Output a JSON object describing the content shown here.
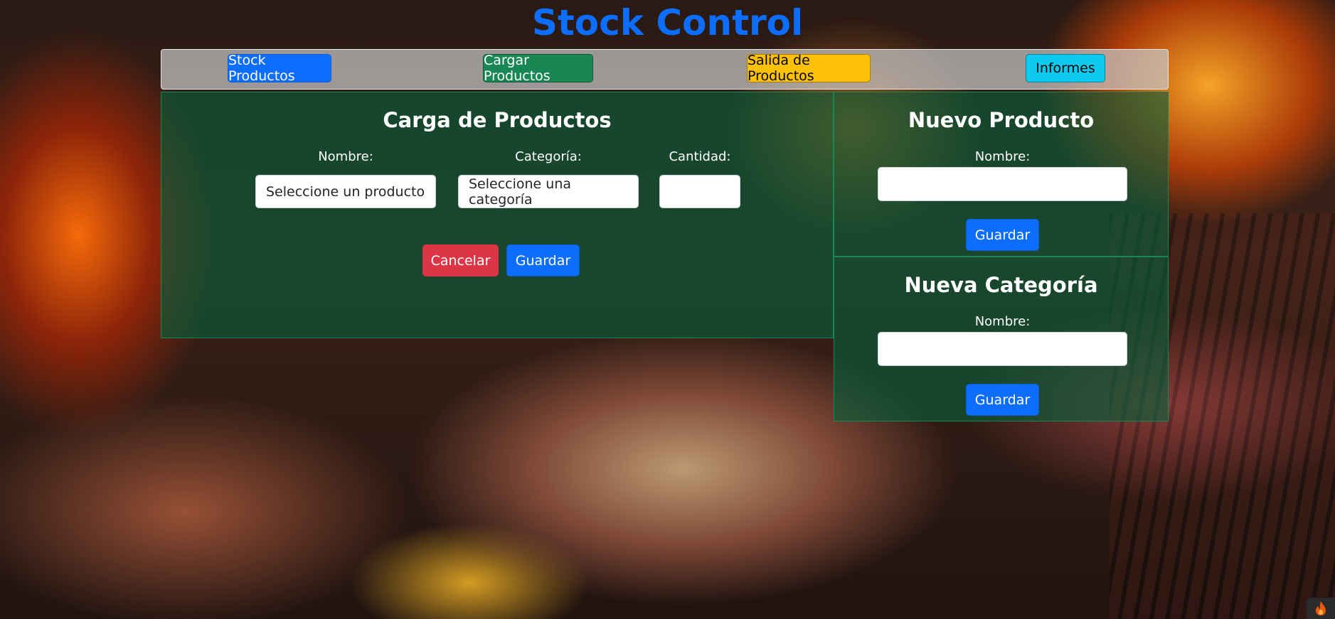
{
  "app": {
    "title": "Stock Control"
  },
  "nav": {
    "stock": "Stock Productos",
    "cargar": "Cargar Productos",
    "salida": "Salida de Productos",
    "informes": "Informes"
  },
  "carga": {
    "title": "Carga de Productos",
    "nombre_label": "Nombre:",
    "categoria_label": "Categoría:",
    "cantidad_label": "Cantidad:",
    "nombre_select": "Seleccione un producto",
    "categoria_select": "Seleccione una categoría",
    "cantidad_value": "",
    "cancel_label": "Cancelar",
    "save_label": "Guardar"
  },
  "nuevo_producto": {
    "title": "Nuevo Producto",
    "nombre_label": "Nombre:",
    "nombre_value": "",
    "save_label": "Guardar"
  },
  "nueva_categoria": {
    "title": "Nueva Categoría",
    "nombre_label": "Nombre:",
    "nombre_value": "",
    "save_label": "Guardar"
  },
  "colors": {
    "primary": "#0d6efd",
    "success": "#198754",
    "warning": "#ffc107",
    "info": "#0dcaf0",
    "danger": "#dc3545"
  },
  "icons": {
    "corner": "flame-icon"
  }
}
